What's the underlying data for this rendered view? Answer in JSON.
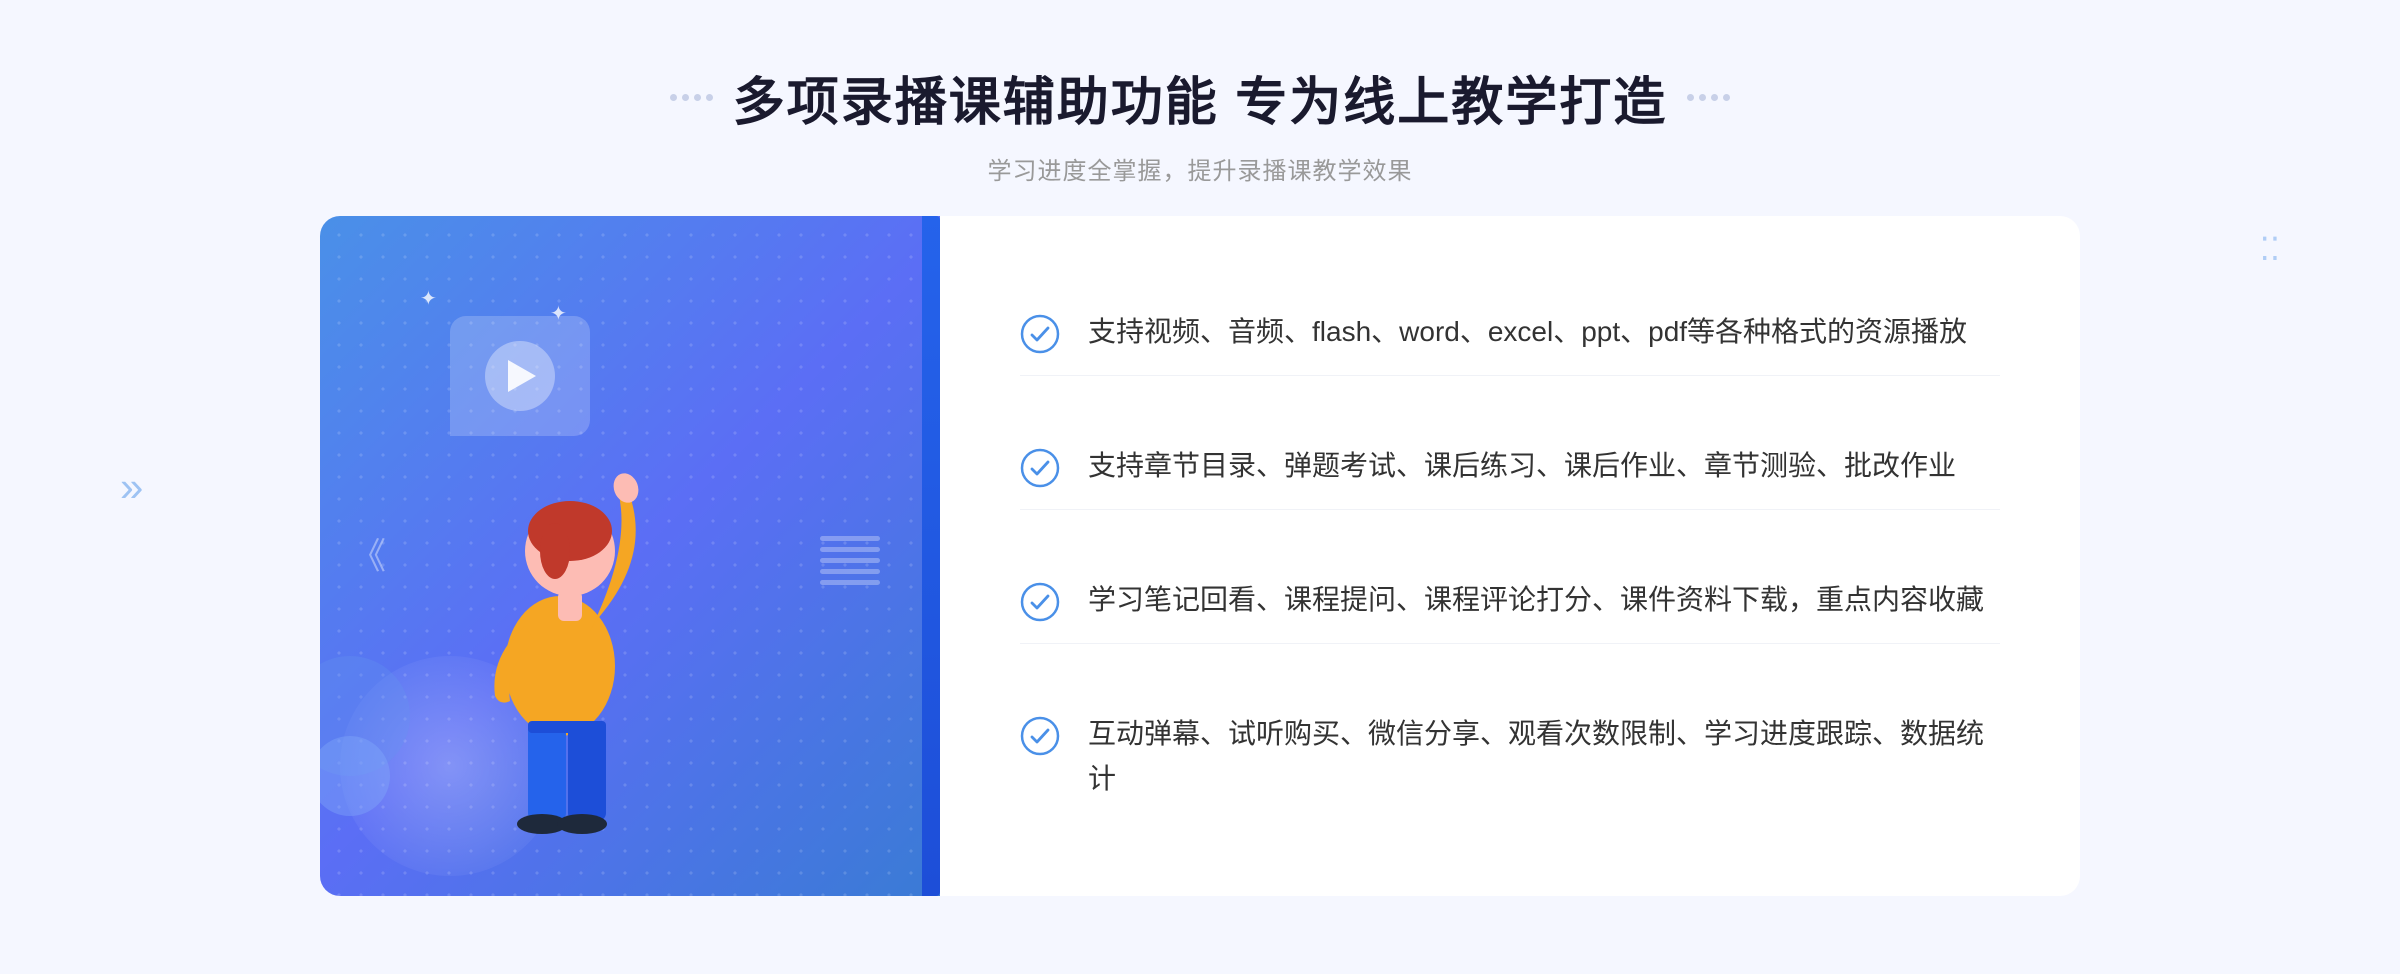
{
  "page": {
    "background_color": "#f0f4fb"
  },
  "header": {
    "main_title": "多项录播课辅助功能 专为线上教学打造",
    "subtitle": "学习进度全掌握，提升录播课教学效果"
  },
  "features": [
    {
      "id": 1,
      "text": "支持视频、音频、flash、word、excel、ppt、pdf等各种格式的资源播放"
    },
    {
      "id": 2,
      "text": "支持章节目录、弹题考试、课后练习、课后作业、章节测验、批改作业"
    },
    {
      "id": 3,
      "text": "学习笔记回看、课程提问、课程评论打分、课件资料下载，重点内容收藏"
    },
    {
      "id": 4,
      "text": "互动弹幕、试听购买、微信分享、观看次数限制、学习进度跟踪、数据统计"
    }
  ],
  "icons": {
    "check_circle": "check-circle-icon",
    "play": "play-icon",
    "chevron": "chevron-left-icon"
  },
  "colors": {
    "primary": "#4a90e8",
    "secondary": "#5b6ef5",
    "accent": "#2563eb",
    "text_dark": "#1a1a2e",
    "text_gray": "#999999",
    "check_color": "#4a90e8"
  }
}
